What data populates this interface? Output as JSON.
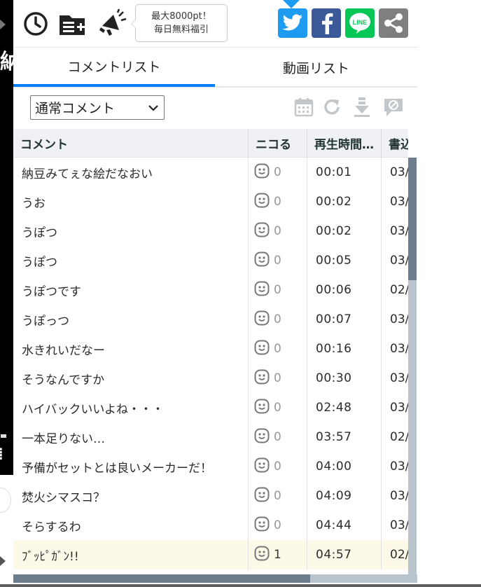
{
  "header": {
    "icons": [
      "history-icon",
      "playlist-add-icon",
      "megaphone-icon"
    ],
    "promo_line1": "最大8000pt！",
    "promo_line2": "毎日無料福引"
  },
  "share": {
    "twitter": {
      "icon": "twitter-icon",
      "color": "#1d9bf0"
    },
    "facebook": {
      "icon": "facebook-icon",
      "color": "#3b5998"
    },
    "line": {
      "icon": "line-icon",
      "label": "LINE",
      "color": "#06c755"
    },
    "other": {
      "icon": "share-icon",
      "color": "#7f7f7f"
    }
  },
  "tabs": [
    {
      "label": "コメントリスト",
      "active": true
    },
    {
      "label": "動画リスト",
      "active": false
    }
  ],
  "accent_color": "#0080ff",
  "toolbar": {
    "select_value": "通常コメント",
    "tools": [
      "calendar-icon",
      "refresh-icon",
      "download-icon",
      "comment-off-icon"
    ]
  },
  "table": {
    "columns": [
      "コメント",
      "ニコる",
      "再生時間…",
      "書込"
    ],
    "rows": [
      {
        "comment": "納豆みてぇな絵だなおい",
        "nicoru": "0",
        "time": "00:01",
        "date": "03/"
      },
      {
        "comment": "うお",
        "nicoru": "0",
        "time": "00:02",
        "date": "03/"
      },
      {
        "comment": "うぽつ",
        "nicoru": "0",
        "time": "00:02",
        "date": "03/"
      },
      {
        "comment": "うぽつ",
        "nicoru": "0",
        "time": "00:05",
        "date": "03/"
      },
      {
        "comment": "うぽつです",
        "nicoru": "0",
        "time": "00:06",
        "date": "02/"
      },
      {
        "comment": "うぽっつ",
        "nicoru": "0",
        "time": "00:07",
        "date": "03/"
      },
      {
        "comment": "水きれいだなー",
        "nicoru": "0",
        "time": "00:16",
        "date": "03/"
      },
      {
        "comment": "そうなんですか",
        "nicoru": "0",
        "time": "00:30",
        "date": "03/"
      },
      {
        "comment": "ハイバックいいよね・・・",
        "nicoru": "0",
        "time": "02:48",
        "date": "03/"
      },
      {
        "comment": "一本足りない…",
        "nicoru": "0",
        "time": "03:57",
        "date": "02/"
      },
      {
        "comment": "予備がセットとは良いメーカーだ！",
        "nicoru": "0",
        "time": "04:00",
        "date": "03/"
      },
      {
        "comment": "焚火シマスコ？",
        "nicoru": "0",
        "time": "04:09",
        "date": "03/"
      },
      {
        "comment": "そらするわ",
        "nicoru": "0",
        "time": "04:44",
        "date": "03/"
      },
      {
        "comment": "ﾌﾞｯﾋﾟｶﾞﾝ!!",
        "nicoru": "1",
        "time": "04:57",
        "date": "02/",
        "highlight": true
      }
    ]
  },
  "video_edge": {
    "text_char": "納"
  }
}
